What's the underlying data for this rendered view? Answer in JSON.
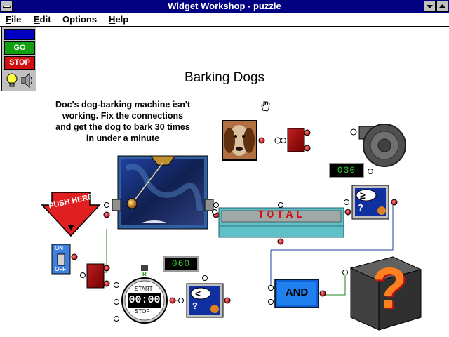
{
  "window": {
    "title": "Widget Workshop - puzzle",
    "system_menu_icon": "system-menu-icon",
    "minimize_icon": "minimize-arrow-icon",
    "maximize_icon": "maximize-arrow-icon"
  },
  "menu": [
    {
      "label": "File",
      "accel": "F",
      "rest": "ile"
    },
    {
      "label": "Edit",
      "accel": "E",
      "rest": "dit"
    },
    {
      "label": "Options",
      "accel": "",
      "rest": "Options"
    },
    {
      "label": "Help",
      "accel": "H",
      "rest": "elp"
    }
  ],
  "controls": {
    "go_label": "GO",
    "stop_label": "STOP"
  },
  "puzzle": {
    "title": "Barking Dogs",
    "description_lines": [
      "Doc's dog-barking machine isn't",
      "working.  Fix the connections",
      "and get the dog to bark 30 times",
      "in under a minute"
    ]
  },
  "widgets": {
    "push_here_label": "PUSH HERE",
    "total_label": "TOTAL",
    "counter_top_value": "030",
    "counter_bottom_value": "060",
    "switch_on": "ON",
    "switch_off": "OFF",
    "timer_value": "00:00",
    "timer_start": "START",
    "timer_stop": "STOP",
    "timer_r": "R",
    "and_label": "AND",
    "compare_gte": "≥",
    "compare_lt": "<",
    "question_glyph": "?"
  },
  "colors": {
    "title_bar": "#000080",
    "accent_red": "#d01010",
    "accent_green": "#109010",
    "and_blue": "#1060d0",
    "total_teal": "#60c0c8"
  }
}
